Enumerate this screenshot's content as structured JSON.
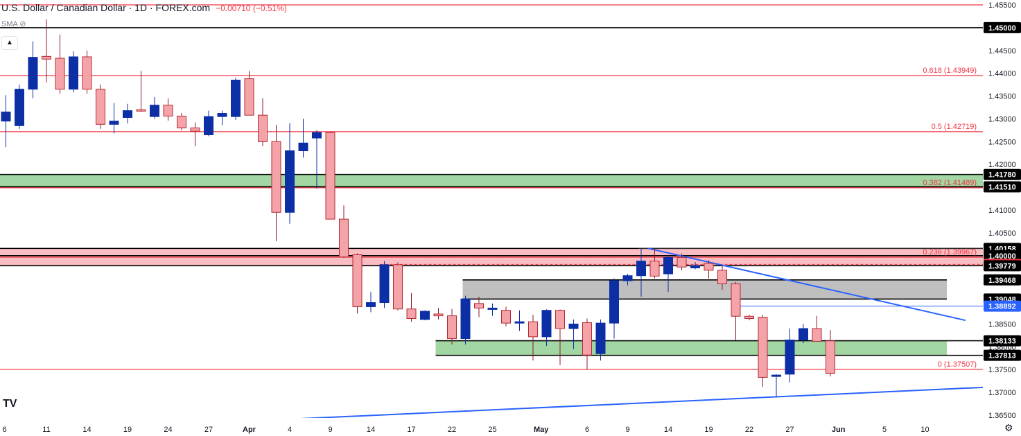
{
  "header": {
    "title": "U.S. Dollar / Canadian Dollar · 1D · FOREX.com",
    "change": "−0.00710 (−0.51%)",
    "indicator": "SMA",
    "indicator_icon": "eye-slash-icon",
    "collapse_icon": "chevron-up-icon",
    "logo": "TV",
    "settings_icon": "gear-icon"
  },
  "colors": {
    "up": "#0d2fa6",
    "down": "#f4a4a9",
    "down_border": "#b52a36",
    "wick": "#8b1a24",
    "red_level": "#f23645",
    "black_level": "#000000",
    "trendline": "#2962ff",
    "green_zone": "#7bc47a",
    "red_zone": "#f7a1a8",
    "gray_zone": "#a9a9a9"
  },
  "chart_data": {
    "type": "candlestick",
    "y_axis_ticks": [
      "1.45500",
      "1.45000",
      "1.44500",
      "1.44000",
      "1.43500",
      "1.43000",
      "1.42500",
      "1.42000",
      "1.41500",
      "1.41000",
      "1.40500",
      "1.40000",
      "1.39500",
      "1.39000",
      "1.38500",
      "1.38000",
      "1.37500",
      "1.37000",
      "1.36500"
    ],
    "ylim": [
      1.3635,
      1.4555
    ],
    "x_axis_ticks": [
      "6",
      "11",
      "14",
      "19",
      "24",
      "27",
      "Apr",
      "4",
      "9",
      "14",
      "17",
      "22",
      "25",
      "May",
      "6",
      "9",
      "14",
      "19",
      "22",
      "27",
      "Jun",
      "5",
      "10"
    ],
    "price_labels": [
      {
        "label": "1.45000",
        "value": 1.45,
        "style": "black"
      },
      {
        "label": "1.41780",
        "value": 1.4178,
        "style": "black"
      },
      {
        "label": "1.41510",
        "value": 1.4151,
        "style": "black"
      },
      {
        "label": "1.40158",
        "value": 1.40158,
        "style": "black"
      },
      {
        "label": "1.40000",
        "value": 1.4,
        "style": "black"
      },
      {
        "label": "1.39808",
        "value": 1.39808,
        "style": "red"
      },
      {
        "label": "1.39779",
        "value": 1.39779,
        "style": "black"
      },
      {
        "label": "1.39468",
        "value": 1.39468,
        "style": "black"
      },
      {
        "label": "1.39048",
        "value": 1.39048,
        "style": "black"
      },
      {
        "label": "1.38892",
        "value": 1.38892,
        "style": "blue"
      },
      {
        "label": "1.38133",
        "value": 1.38133,
        "style": "black"
      },
      {
        "label": "1.37813",
        "value": 1.37813,
        "style": "black"
      }
    ],
    "fib_levels": [
      {
        "label": "0.618 (1.43949)",
        "value": 1.43949
      },
      {
        "label": "0.5 (1.42719)",
        "value": 1.42719
      },
      {
        "label": "0.382 (1.41489)",
        "value": 1.41489
      },
      {
        "label": "0.236 (1.39967)",
        "value": 1.39967
      },
      {
        "label": "0 (1.37507)",
        "value": 1.37507
      },
      {
        "label": "",
        "value": 1.455
      }
    ],
    "black_levels": [
      1.45,
      1.4178,
      1.4151,
      1.40158,
      1.4,
      1.39779,
      1.39468,
      1.39048,
      1.38133,
      1.37813
    ],
    "zones": [
      {
        "name": "upper-support-zone",
        "from": 1.4151,
        "to": 1.4178,
        "color": "green",
        "start_index": 0
      },
      {
        "name": "resistance-zone",
        "from": 1.39779,
        "to": 1.40158,
        "color": "red",
        "start_index": 0
      },
      {
        "name": "mid-zone",
        "from": 1.39048,
        "to": 1.39468,
        "color": "gray",
        "start_index": 34
      },
      {
        "name": "support-zone",
        "from": 1.37813,
        "to": 1.38133,
        "color": "green",
        "start_index": 32
      }
    ],
    "dashed_level": {
      "value": 1.39808,
      "start_index": 28
    },
    "marker_levels": [
      {
        "value": 1.40158,
        "start_index": 47
      },
      {
        "value": 1.38892,
        "start_index": 54
      }
    ],
    "trendlines": [
      {
        "name": "descending-trendline",
        "from": {
          "index": 47.5,
          "value": 1.4016
        },
        "to": {
          "index": 71,
          "value": 1.3858
        }
      },
      {
        "name": "ascending-trendline",
        "from": {
          "index": 21.5,
          "value": 1.3642
        },
        "to": {
          "index": 73,
          "value": 1.3712
        }
      }
    ],
    "candles": [
      {
        "o": 1.4295,
        "h": 1.4352,
        "l": 1.4238,
        "c": 1.4315
      },
      {
        "o": 1.4285,
        "h": 1.4375,
        "l": 1.4278,
        "c": 1.4365
      },
      {
        "o": 1.4365,
        "h": 1.447,
        "l": 1.4345,
        "c": 1.4435
      },
      {
        "o": 1.4437,
        "h": 1.4518,
        "l": 1.438,
        "c": 1.4431
      },
      {
        "o": 1.4433,
        "h": 1.4485,
        "l": 1.4355,
        "c": 1.4365
      },
      {
        "o": 1.4365,
        "h": 1.4448,
        "l": 1.4358,
        "c": 1.4436
      },
      {
        "o": 1.4436,
        "h": 1.445,
        "l": 1.4355,
        "c": 1.4365
      },
      {
        "o": 1.4365,
        "h": 1.4375,
        "l": 1.4278,
        "c": 1.4288
      },
      {
        "o": 1.4288,
        "h": 1.4335,
        "l": 1.4268,
        "c": 1.4295
      },
      {
        "o": 1.4303,
        "h": 1.4333,
        "l": 1.429,
        "c": 1.4318
      },
      {
        "o": 1.432,
        "h": 1.4405,
        "l": 1.4315,
        "c": 1.4318
      },
      {
        "o": 1.4305,
        "h": 1.4348,
        "l": 1.43,
        "c": 1.433
      },
      {
        "o": 1.433,
        "h": 1.4345,
        "l": 1.4296,
        "c": 1.4306
      },
      {
        "o": 1.4306,
        "h": 1.4313,
        "l": 1.4275,
        "c": 1.428
      },
      {
        "o": 1.428,
        "h": 1.4292,
        "l": 1.424,
        "c": 1.4273
      },
      {
        "o": 1.4265,
        "h": 1.4318,
        "l": 1.4262,
        "c": 1.4305
      },
      {
        "o": 1.4305,
        "h": 1.4318,
        "l": 1.4286,
        "c": 1.4312
      },
      {
        "o": 1.4305,
        "h": 1.439,
        "l": 1.4298,
        "c": 1.4385
      },
      {
        "o": 1.4388,
        "h": 1.4405,
        "l": 1.4308,
        "c": 1.4308
      },
      {
        "o": 1.4308,
        "h": 1.4345,
        "l": 1.424,
        "c": 1.425
      },
      {
        "o": 1.425,
        "h": 1.4287,
        "l": 1.4032,
        "c": 1.4095
      },
      {
        "o": 1.4095,
        "h": 1.429,
        "l": 1.407,
        "c": 1.423
      },
      {
        "o": 1.423,
        "h": 1.43,
        "l": 1.4215,
        "c": 1.4247
      },
      {
        "o": 1.4258,
        "h": 1.4275,
        "l": 1.4147,
        "c": 1.427
      },
      {
        "o": 1.427,
        "h": 1.4272,
        "l": 1.408,
        "c": 1.408
      },
      {
        "o": 1.408,
        "h": 1.411,
        "l": 1.3995,
        "c": 1.3997
      },
      {
        "o": 1.4002,
        "h": 1.4005,
        "l": 1.3873,
        "c": 1.3888
      },
      {
        "o": 1.3888,
        "h": 1.392,
        "l": 1.3876,
        "c": 1.3897
      },
      {
        "o": 1.3897,
        "h": 1.3988,
        "l": 1.3885,
        "c": 1.398
      },
      {
        "o": 1.398,
        "h": 1.3985,
        "l": 1.388,
        "c": 1.3883
      },
      {
        "o": 1.3883,
        "h": 1.3918,
        "l": 1.3855,
        "c": 1.3862
      },
      {
        "o": 1.386,
        "h": 1.388,
        "l": 1.3858,
        "c": 1.3878
      },
      {
        "o": 1.3872,
        "h": 1.3885,
        "l": 1.386,
        "c": 1.3868
      },
      {
        "o": 1.3868,
        "h": 1.3883,
        "l": 1.3805,
        "c": 1.3818
      },
      {
        "o": 1.3818,
        "h": 1.3912,
        "l": 1.3805,
        "c": 1.3905
      },
      {
        "o": 1.3895,
        "h": 1.391,
        "l": 1.3865,
        "c": 1.3885
      },
      {
        "o": 1.3885,
        "h": 1.3895,
        "l": 1.3868,
        "c": 1.3885
      },
      {
        "o": 1.388,
        "h": 1.3888,
        "l": 1.3845,
        "c": 1.3852
      },
      {
        "o": 1.3852,
        "h": 1.388,
        "l": 1.3835,
        "c": 1.3855
      },
      {
        "o": 1.3855,
        "h": 1.387,
        "l": 1.377,
        "c": 1.3822
      },
      {
        "o": 1.3822,
        "h": 1.3882,
        "l": 1.3802,
        "c": 1.388
      },
      {
        "o": 1.388,
        "h": 1.3882,
        "l": 1.376,
        "c": 1.384
      },
      {
        "o": 1.384,
        "h": 1.386,
        "l": 1.3795,
        "c": 1.385
      },
      {
        "o": 1.3853,
        "h": 1.3862,
        "l": 1.375,
        "c": 1.3782
      },
      {
        "o": 1.3785,
        "h": 1.386,
        "l": 1.377,
        "c": 1.3852
      },
      {
        "o": 1.3852,
        "h": 1.395,
        "l": 1.3818,
        "c": 1.3945
      },
      {
        "o": 1.3945,
        "h": 1.396,
        "l": 1.3935,
        "c": 1.3956
      },
      {
        "o": 1.3956,
        "h": 1.4016,
        "l": 1.391,
        "c": 1.3988
      },
      {
        "o": 1.3988,
        "h": 1.4016,
        "l": 1.395,
        "c": 1.3955
      },
      {
        "o": 1.396,
        "h": 1.4,
        "l": 1.392,
        "c": 1.3996
      },
      {
        "o": 1.3996,
        "h": 1.4005,
        "l": 1.3968,
        "c": 1.3975
      },
      {
        "o": 1.3973,
        "h": 1.3986,
        "l": 1.397,
        "c": 1.3978
      },
      {
        "o": 1.3983,
        "h": 1.399,
        "l": 1.395,
        "c": 1.3968
      },
      {
        "o": 1.3968,
        "h": 1.3978,
        "l": 1.3925,
        "c": 1.3938
      },
      {
        "o": 1.3938,
        "h": 1.3942,
        "l": 1.3815,
        "c": 1.3867
      },
      {
        "o": 1.3867,
        "h": 1.387,
        "l": 1.3858,
        "c": 1.3862
      },
      {
        "o": 1.3865,
        "h": 1.387,
        "l": 1.3712,
        "c": 1.3733
      },
      {
        "o": 1.3735,
        "h": 1.374,
        "l": 1.369,
        "c": 1.3738
      },
      {
        "o": 1.374,
        "h": 1.384,
        "l": 1.3722,
        "c": 1.3815
      },
      {
        "o": 1.3815,
        "h": 1.385,
        "l": 1.3808,
        "c": 1.384
      },
      {
        "o": 1.384,
        "h": 1.3868,
        "l": 1.3815,
        "c": 1.3812
      },
      {
        "o": 1.3813,
        "h": 1.3837,
        "l": 1.3735,
        "c": 1.3742
      }
    ]
  }
}
